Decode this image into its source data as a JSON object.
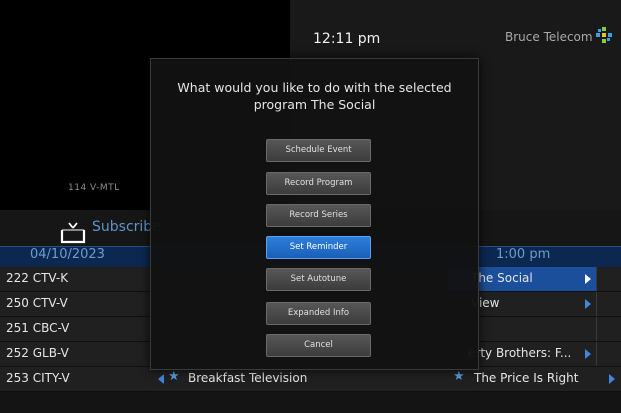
{
  "header": {
    "clock": "12:11 pm",
    "brand": "Bruce Telecom",
    "channel_info": "114   V-MTL"
  },
  "subscribe": {
    "label": "Subscribe"
  },
  "guide": {
    "date": "04/10/2023",
    "time_slot": "1:00 pm",
    "rows": [
      {
        "channel": "222 CTV-K",
        "program_right": "The Social"
      },
      {
        "channel": "250 CTV-V",
        "program_right": "View"
      },
      {
        "channel": "251 CBC-V",
        "program_right": ""
      },
      {
        "channel": "252 GLB-V",
        "program_right": "erty Brothers: F..."
      },
      {
        "channel": "253 CITY-V",
        "program_left": "Breakfast Television",
        "program_right": "The Price Is Right"
      }
    ]
  },
  "modal": {
    "title": "What would you like to do with the selected program The Social",
    "buttons": [
      {
        "label": "Schedule Event",
        "active": false
      },
      {
        "label": "Record Program",
        "active": false
      },
      {
        "label": "Record Series",
        "active": false
      },
      {
        "label": "Set Reminder",
        "active": true
      },
      {
        "label": "Set Autotune",
        "active": false
      },
      {
        "label": "Expanded Info",
        "active": false
      },
      {
        "label": "Cancel",
        "active": false
      }
    ]
  },
  "colors": {
    "accent": "#3f86e0",
    "header_text": "#6c9bd2",
    "selected_cell": "#1b4f9b",
    "active_button": "#2f7fdc"
  }
}
